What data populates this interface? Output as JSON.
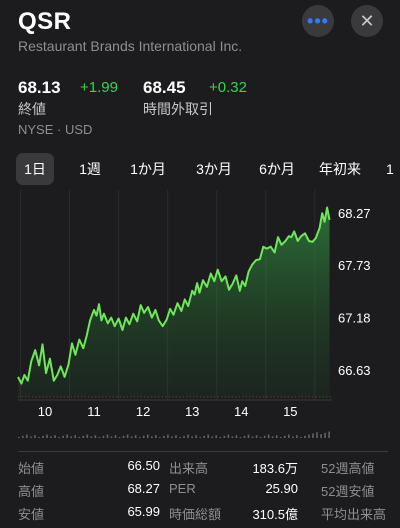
{
  "header": {
    "ticker": "QSR",
    "company": "Restaurant Brands International Inc.",
    "more_icon": "ellipsis-icon",
    "close_icon": "close-icon",
    "close_glyph": "✕",
    "more_glyph": "•••"
  },
  "quote": {
    "close_price": "68.13",
    "close_change": "+1.99",
    "close_label": "終値",
    "after_price": "68.45",
    "after_change": "+0.32",
    "after_label": "時間外取引",
    "exchange": "NYSE · USD"
  },
  "tabs": [
    "1日",
    "1週",
    "1か月",
    "3か月",
    "6か月",
    "年初来",
    "1"
  ],
  "selected_tab": "1日",
  "colors": {
    "accent_green": "#32d74b",
    "line_green": "#6ee85a",
    "background": "#1c1c1e",
    "link_blue": "#2f7df6"
  },
  "chart_data": {
    "type": "area",
    "x_tick_labels": [
      "10",
      "11",
      "12",
      "13",
      "14",
      "15"
    ],
    "y_tick_labels": [
      "68.27",
      "67.73",
      "67.18",
      "66.63"
    ],
    "y_ticks": [
      68.27,
      67.73,
      67.18,
      66.63
    ],
    "ylim": [
      66.35,
      68.45
    ],
    "x_range": [
      9.45,
      15.85
    ],
    "grid": "vertical",
    "x": [
      9.45,
      9.52,
      9.58,
      9.65,
      9.72,
      9.8,
      9.88,
      9.95,
      10.02,
      10.1,
      10.18,
      10.25,
      10.32,
      10.4,
      10.48,
      10.55,
      10.62,
      10.7,
      10.78,
      10.85,
      10.92,
      11.0,
      11.05,
      11.1,
      11.15,
      11.2,
      11.28,
      11.35,
      11.42,
      11.5,
      11.58,
      11.65,
      11.72,
      11.8,
      11.88,
      11.95,
      12.02,
      12.1,
      12.18,
      12.25,
      12.32,
      12.4,
      12.48,
      12.55,
      12.62,
      12.7,
      12.78,
      12.85,
      12.92,
      13.0,
      13.05,
      13.1,
      13.15,
      13.22,
      13.3,
      13.38,
      13.45,
      13.52,
      13.6,
      13.68,
      13.75,
      13.82,
      13.9,
      13.97,
      14.02,
      14.08,
      14.15,
      14.22,
      14.3,
      14.38,
      14.45,
      14.52,
      14.6,
      14.68,
      14.75,
      14.82,
      14.9,
      14.97,
      15.02,
      15.08,
      15.15,
      15.22,
      15.3,
      15.38,
      15.45,
      15.52,
      15.6,
      15.65,
      15.7,
      15.75,
      15.8
    ],
    "values": [
      66.56,
      66.49,
      66.58,
      66.52,
      66.72,
      66.84,
      66.68,
      66.9,
      66.6,
      66.75,
      66.52,
      66.58,
      66.67,
      66.56,
      66.69,
      66.91,
      66.79,
      66.95,
      66.86,
      66.99,
      67.15,
      67.26,
      67.2,
      67.32,
      67.15,
      67.22,
      67.12,
      67.18,
      67.09,
      67.17,
      67.05,
      67.18,
      67.11,
      67.22,
      67.14,
      67.31,
      67.23,
      67.29,
      67.18,
      67.26,
      67.15,
      67.09,
      67.16,
      67.27,
      67.21,
      67.33,
      67.25,
      67.37,
      67.3,
      67.46,
      67.42,
      67.54,
      67.44,
      67.57,
      67.5,
      67.64,
      67.56,
      67.68,
      67.56,
      67.61,
      67.47,
      67.53,
      67.62,
      67.46,
      67.56,
      67.51,
      67.66,
      67.73,
      67.78,
      67.79,
      67.92,
      67.9,
      67.92,
      67.86,
      68.02,
      67.94,
      67.98,
      68.03,
      68.02,
      68.08,
      67.98,
      68.03,
      68.06,
      67.98,
      67.97,
      68.01,
      68.12,
      68.27,
      68.18,
      68.33,
      68.2
    ]
  },
  "stats": [
    {
      "label": "始値",
      "value": "66.50"
    },
    {
      "label": "高値",
      "value": "68.27"
    },
    {
      "label": "安値",
      "value": "65.99"
    }
  ],
  "stats2": [
    {
      "label": "出来高",
      "value": "183.6万"
    },
    {
      "label": "PER",
      "value": "25.90"
    },
    {
      "label": "時価総額",
      "value": "310.5億"
    }
  ],
  "stats3": [
    {
      "label": "52週高値"
    },
    {
      "label": "52週安値"
    },
    {
      "label": "平均出来高"
    }
  ]
}
